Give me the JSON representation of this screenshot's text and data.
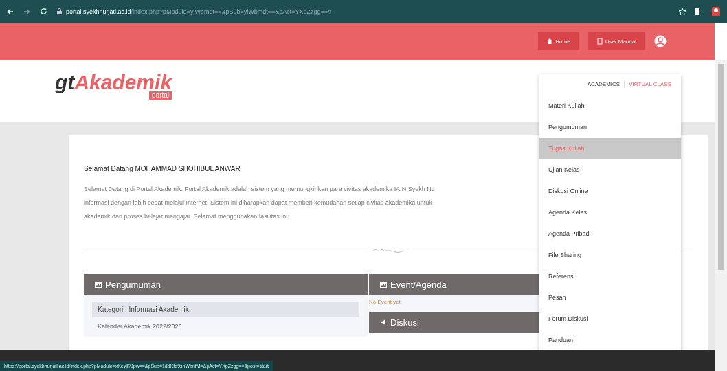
{
  "browser": {
    "domain": "portal.syekhnurjati.ac.id",
    "path": "/index.php?pModule=yiWbmdt==&pSub=yiWbmdt==&pAct=YXpZzgg==#"
  },
  "header": {
    "buttons": [
      {
        "label": "Home",
        "kind": "home"
      },
      {
        "label": "User Manual",
        "kind": "manual"
      }
    ]
  },
  "logo": {
    "prefix": "gt",
    "main": "Akademik",
    "badge": "portal"
  },
  "nav": [
    {
      "label": "ACADEMICS",
      "selected": false
    },
    {
      "label": "VIRTUAL CLASS",
      "selected": true
    }
  ],
  "menu": [
    {
      "label": "Materi Kuliah",
      "selected": false
    },
    {
      "label": "Pengumuman",
      "selected": false
    },
    {
      "label": "Tugas Kuliah",
      "selected": true
    },
    {
      "label": "Ujian Kelas",
      "selected": false
    },
    {
      "label": "Diskusi Online",
      "selected": false
    },
    {
      "label": "Agenda Kelas",
      "selected": false
    },
    {
      "label": "Agenda Pribadi",
      "selected": false
    },
    {
      "label": "File Sharing",
      "selected": false
    },
    {
      "label": "Referensi",
      "selected": false
    },
    {
      "label": "Pesan",
      "selected": false
    },
    {
      "label": "Forum Diskusi",
      "selected": false
    },
    {
      "label": "Panduan",
      "selected": false
    }
  ],
  "welcome": {
    "title": "Selamat Datang MOHAMMAD SHOHIBUL ANWAR",
    "lines": [
      "Selamat Datang di Portal Akademik. Portal Akademik adalah sistem yang memungkinkan para civitas akademika IAIN Syekh Nu",
      "informasi dengan lebih cepat melalui Internet. Sistem ini diharapkan dapat memberi kemudahan setiap civitas akademika untuk",
      "akademik dan proses belajar mengajar. Selamat menggunakan fasilitas ini."
    ]
  },
  "announcements": {
    "title": "Pengumuman",
    "category": "Kategori : Informasi Akademik",
    "item": "Kalender Akademik 2022/2023"
  },
  "events": {
    "title": "Event/Agenda",
    "empty": "No Event yet."
  },
  "discussion": {
    "title": "Diskusi"
  },
  "status_bar": {
    "url": "https://portal.syekhnurjati.ac.id/index.php?pModule=xKeyjl?Jpw==&pSub=1ddKfq9snWbnfM=&pAct=YXpZzgg==&post=start"
  }
}
